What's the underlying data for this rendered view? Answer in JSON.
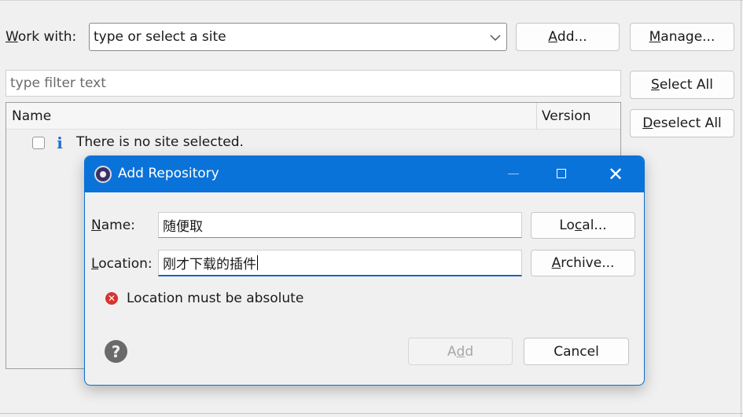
{
  "work_with": {
    "label": "Work with:",
    "accesskey": "W",
    "label_rest": "ork with:",
    "placeholder": "type or select a site",
    "add_button": "Add...",
    "add_accesskey": "A",
    "add_rest": "dd...",
    "manage_button": "Manage...",
    "manage_accesskey": "M",
    "manage_rest": "anage..."
  },
  "filter": {
    "placeholder": "type filter text",
    "select_all_accesskey": "S",
    "select_all_rest": "elect All",
    "deselect_all_accesskey": "D",
    "deselect_all_rest": "eselect All"
  },
  "table": {
    "columns": [
      "Name",
      "Version"
    ],
    "rows": [
      {
        "checked": false,
        "icon": "info-icon",
        "text": "There is no site selected."
      }
    ]
  },
  "dialog": {
    "title": "Add Repository",
    "name_label_key": "N",
    "name_label_rest": "ame:",
    "name_value": "随便取",
    "location_label_key": "L",
    "location_label_rest": "ocation:",
    "location_value": "刚才下载的插件",
    "local_button_pre": "Lo",
    "local_button_key": "c",
    "local_button_rest": "al...",
    "archive_button_key": "A",
    "archive_button_rest": "rchive...",
    "error_message": "Location must be absolute",
    "add_button_pre": "A",
    "add_button_key": "d",
    "add_button_rest": "d",
    "cancel_button": "Cancel",
    "close_glyph": "✕"
  },
  "colors": {
    "titlebar": "#0a73d9",
    "error": "#d9332e",
    "info": "#1f6fd0"
  }
}
